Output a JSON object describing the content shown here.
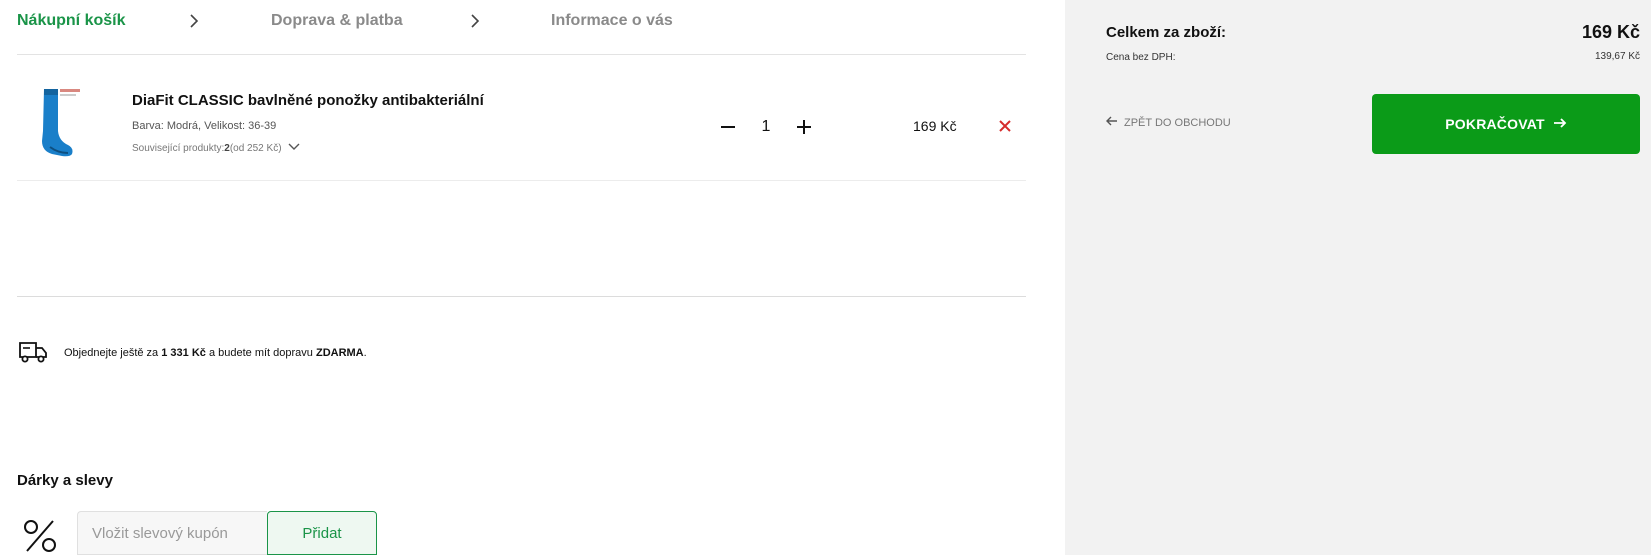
{
  "steps": {
    "step1": "Nákupní košík",
    "step2": "Doprava & platba",
    "step3": "Informace o vás"
  },
  "product": {
    "name": "DiaFit CLASSIC bavlněné ponožky antibakteriální",
    "variant": "Barva: Modrá, Velikost: 36-39",
    "related_prefix": "Související produkty: ",
    "related_count": "2",
    "related_suffix": " (od 252 Kč)",
    "quantity": "1",
    "price": "169 Kč",
    "image_color": "#1a7fc9"
  },
  "shipping": {
    "prefix": "Objednejte ještě za ",
    "amount": "1 331 Kč",
    "middle": " a budete mít dopravu ",
    "free": "ZDARMA",
    "suffix": "."
  },
  "gifts": {
    "title": "Dárky a slevy",
    "coupon_placeholder": "Vložit slevový kupón",
    "add_label": "Přidat"
  },
  "summary": {
    "total_label": "Celkem za zboží:",
    "total_value": "169 Kč",
    "vat_label": "Cena bez DPH:",
    "vat_value": "139,67 Kč",
    "back_label": "ZPĚT DO OBCHODU",
    "continue_label": "POKRAČOVAT"
  },
  "colors": {
    "accent_green": "#1a9448",
    "button_green": "#0b9b18",
    "remove_red": "#d62b2b",
    "sidebar_bg": "#f2f2f2"
  },
  "icons": [
    "chevron-right-icon",
    "sock-product-image",
    "minus-icon",
    "plus-icon",
    "close-icon",
    "chevron-down-icon",
    "delivery-truck-icon",
    "percent-icon",
    "arrow-left-icon",
    "arrow-right-icon"
  ]
}
